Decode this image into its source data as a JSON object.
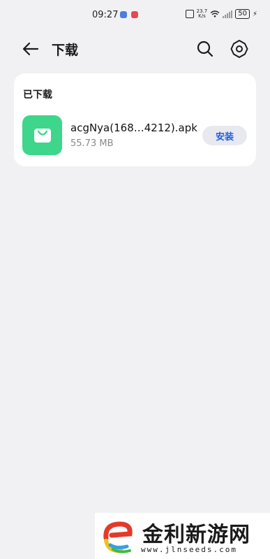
{
  "status_bar": {
    "time": "09:27",
    "net_speed_value": "23.7",
    "net_speed_unit": "K/s",
    "battery": "50"
  },
  "header": {
    "title": "下载",
    "back_icon": "arrow-left-icon",
    "search_icon": "search-icon",
    "settings_icon": "gear-icon"
  },
  "downloads": {
    "section_title": "已下载",
    "items": [
      {
        "file_name": "acgNya(168…4212).apk",
        "size": "55.73 MB",
        "action_label": "安装",
        "icon": "shopping-bag-icon",
        "icon_color": "#3ed68a"
      }
    ]
  },
  "watermark": {
    "title": "金利新游网",
    "url": "www.jlnseeds.com"
  },
  "colors": {
    "background": "#f1f1f3",
    "card": "#ffffff",
    "accent": "#1f5fe0"
  }
}
